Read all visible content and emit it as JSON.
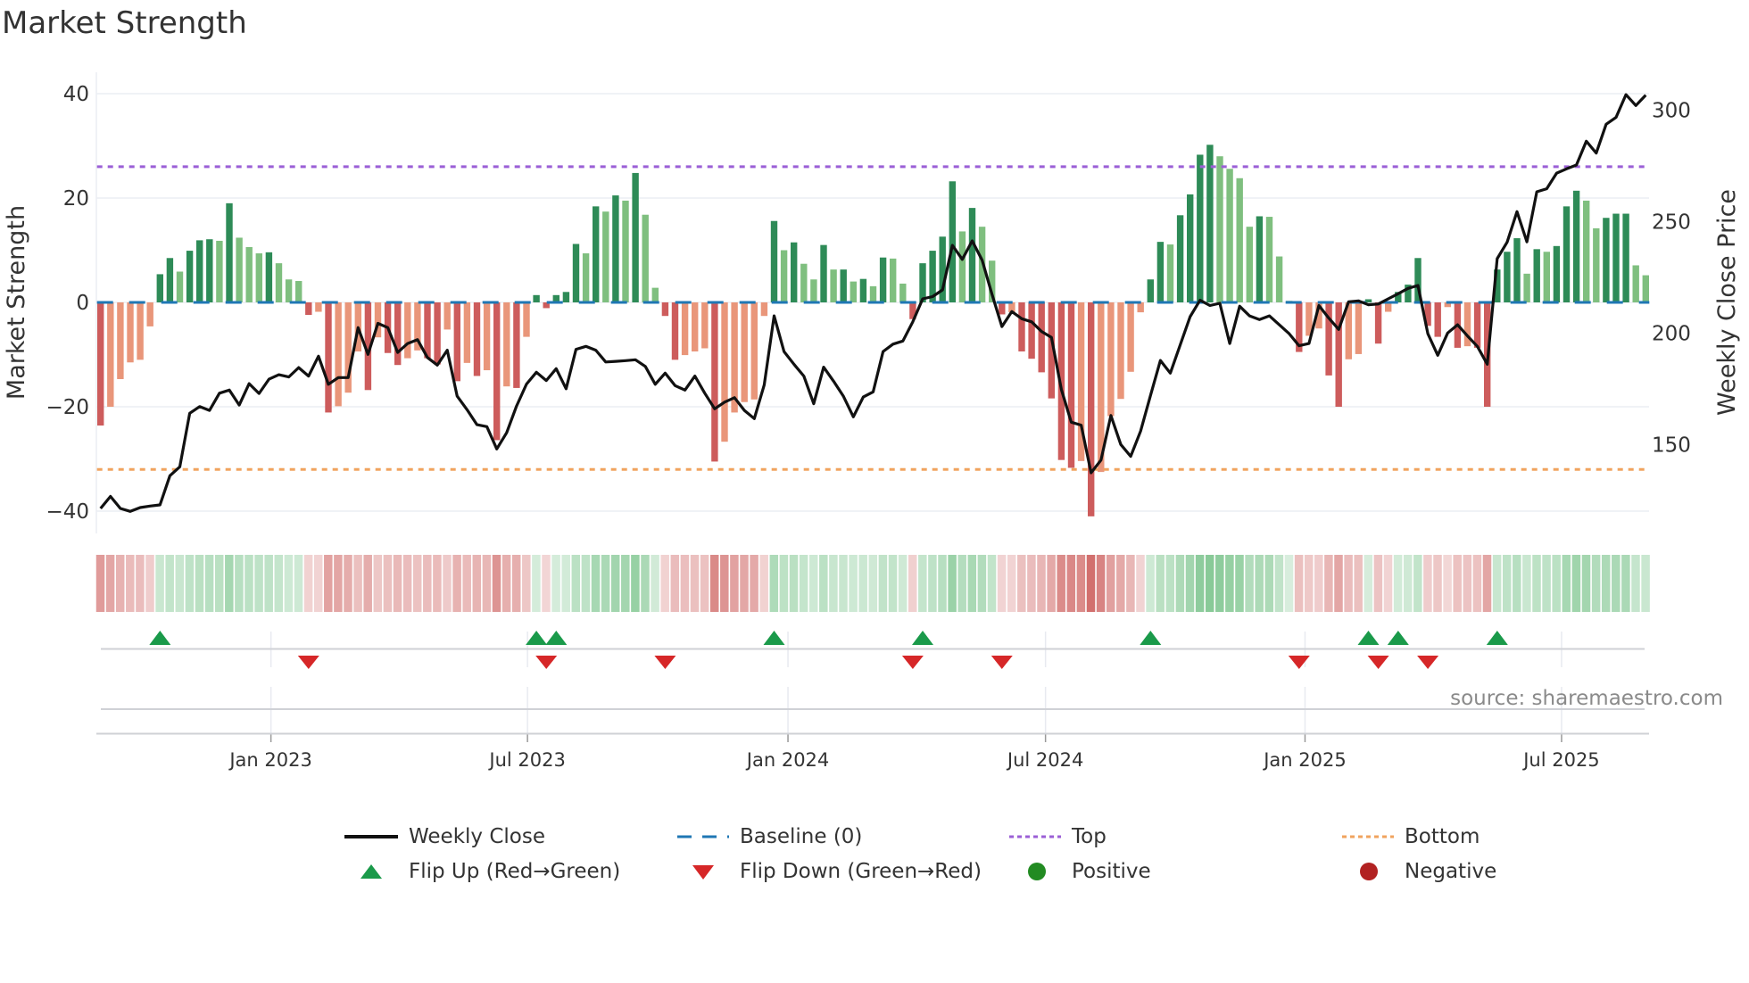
{
  "chart_data": {
    "type": "bar",
    "title": "Market Strength",
    "ylabel": "Market Strength",
    "y2label": "Weekly Close Price",
    "ylim": [
      -44,
      44
    ],
    "y2lim": [
      110,
      317
    ],
    "yticks": [
      {
        "v": 40,
        "label": "40"
      },
      {
        "v": 20,
        "label": "20"
      },
      {
        "v": 0,
        "label": "0"
      },
      {
        "v": -20,
        "label": "−20"
      },
      {
        "v": -40,
        "label": "−40"
      }
    ],
    "y2ticks": [
      {
        "v": 300,
        "label": "300"
      },
      {
        "v": 250,
        "label": "250"
      },
      {
        "v": 200,
        "label": "200"
      },
      {
        "v": 150,
        "label": "150"
      }
    ],
    "xticks": [
      {
        "week": 17.2,
        "label": "Jan 2023"
      },
      {
        "week": 43.1,
        "label": "Jul 2023"
      },
      {
        "week": 69.4,
        "label": "Jan 2024"
      },
      {
        "week": 95.4,
        "label": "Jul 2024"
      },
      {
        "week": 121.6,
        "label": "Jan 2025"
      },
      {
        "week": 147.5,
        "label": "Jul 2025"
      }
    ],
    "top_level": 26,
    "bottom_level": -32,
    "baseline": 0,
    "strength": [
      -23.6,
      -20,
      -14.7,
      -11.5,
      -11,
      -4.6,
      5.4,
      8.5,
      5.9,
      9.9,
      11.9,
      12.1,
      11.8,
      19,
      12.4,
      10.6,
      9.4,
      9.6,
      7.5,
      4.4,
      4.1,
      -2.4,
      -1.8,
      -21.1,
      -19.9,
      -17.3,
      -9.4,
      -16.8,
      -6.7,
      -9.7,
      -12,
      -10.7,
      -9.2,
      -10.7,
      -11.9,
      -5.2,
      -15.1,
      -11.6,
      -14.1,
      -13,
      -26.4,
      -16.1,
      -16.4,
      -6.6,
      1.4,
      -1.1,
      1.4,
      2.0,
      11.2,
      9.4,
      18.4,
      17.4,
      20.5,
      19.5,
      24.8,
      16.8,
      2.8,
      -2.6,
      -11,
      -10.1,
      -9.4,
      -8.8,
      -30.5,
      -26.7,
      -21.1,
      -19.1,
      -18.6,
      -2.6,
      15.6,
      10,
      11.5,
      7.4,
      4.4,
      11,
      6.3,
      6.3,
      4,
      4.5,
      3.1,
      8.6,
      8.4,
      3.6,
      -3.2,
      7.5,
      9.9,
      12.6,
      23.2,
      13.6,
      18.1,
      14.5,
      8,
      -2.3,
      -1.9,
      -9.4,
      -10.8,
      -13.4,
      -18.4,
      -30.2,
      -31.7,
      -30.4,
      -41,
      -32.5,
      -21.8,
      -18.5,
      -13.3,
      -1.9,
      4.4,
      11.6,
      11.1,
      16.7,
      20.7,
      28.3,
      30.2,
      28,
      25.6,
      23.8,
      14.5,
      16.5,
      16.4,
      8.8,
      0.3,
      -9.5,
      -6.4,
      -5,
      -14,
      -20,
      -10.9,
      -9.9,
      0.6,
      -7.9,
      -1.8,
      2,
      3.4,
      8.5,
      -4.5,
      -6.6,
      -0.9,
      -8.7,
      -8.4,
      -8.7,
      -20,
      6.3,
      9.7,
      12.3,
      5.5,
      10.2,
      9.7,
      10.8,
      18.4,
      21.4,
      19.5,
      14.2,
      16.2,
      17,
      17,
      7.1,
      5.2
    ],
    "weekly_close": [
      121.3,
      126.7,
      121.3,
      120,
      121.7,
      122.4,
      122.9,
      136,
      140,
      164,
      167,
      165.3,
      173,
      174.4,
      167.7,
      177.3,
      172.9,
      179.3,
      181.3,
      180.3,
      184.5,
      180.7,
      189.6,
      177,
      180,
      180,
      202.4,
      190.4,
      204.3,
      202.4,
      191.3,
      195.3,
      197,
      189,
      185.6,
      192.3,
      171.7,
      165.6,
      158.9,
      158,
      148,
      155.3,
      167.3,
      177.1,
      182.4,
      178.7,
      184,
      175,
      192.7,
      194,
      192.3,
      187,
      187.3,
      187.6,
      188,
      185,
      177,
      182,
      176.4,
      174.4,
      180.7,
      173,
      166,
      169,
      171,
      165.3,
      161.6,
      176.7,
      207.7,
      191.7,
      186,
      180.7,
      168.3,
      184.7,
      178.4,
      171.6,
      162.4,
      171.3,
      173.6,
      191.7,
      195,
      196.4,
      205,
      215.3,
      216.3,
      219.3,
      239.3,
      233,
      241.3,
      232.7,
      217.3,
      202.9,
      209.6,
      206.4,
      205,
      200.7,
      198,
      174.7,
      160,
      158.7,
      137.3,
      143,
      163,
      150,
      144.7,
      156,
      172,
      187.7,
      182,
      194.7,
      207.3,
      214.7,
      212.3,
      213.3,
      195.3,
      212,
      207.7,
      206,
      207.7,
      203.7,
      199.7,
      194.3,
      195.3,
      212.3,
      206.7,
      201.6,
      214,
      214.4,
      212.7,
      213,
      215.3,
      217.6,
      220,
      221.3,
      199.7,
      190,
      200,
      203.7,
      198.7,
      194,
      186,
      233.3,
      240.7,
      254.4,
      240.9,
      263.3,
      264.7,
      271.7,
      273.6,
      275.3,
      286,
      280.7,
      293.6,
      296.7,
      306.9,
      302,
      306.7
    ],
    "flip_up_weeks": [
      6,
      44,
      46,
      68,
      83,
      106,
      128,
      131,
      141
    ],
    "flip_down_weeks": [
      21,
      45,
      57,
      82,
      91,
      121,
      129,
      134
    ],
    "colors": {
      "pos_up": "#2e8b57",
      "pos_down": "#7fbf7f",
      "neg_down": "#cd5c5c",
      "neg_up": "#e9967a",
      "line": "#111111",
      "baseline": "#1f77b4",
      "top": "#9b5fd6",
      "bottom": "#f0a35e",
      "flip_up": "#1a9a4a",
      "flip_down": "#d62728",
      "positive": "#228b22",
      "negative": "#b22222"
    },
    "legend": {
      "weekly_close": "Weekly Close",
      "baseline": "Baseline (0)",
      "top": "Top",
      "bottom": "Bottom",
      "flip_up": "Flip Up (Red→Green)",
      "flip_down": "Flip Down (Green→Red)",
      "positive": "Positive",
      "negative": "Negative"
    },
    "source": "source: sharemaestro.com"
  }
}
